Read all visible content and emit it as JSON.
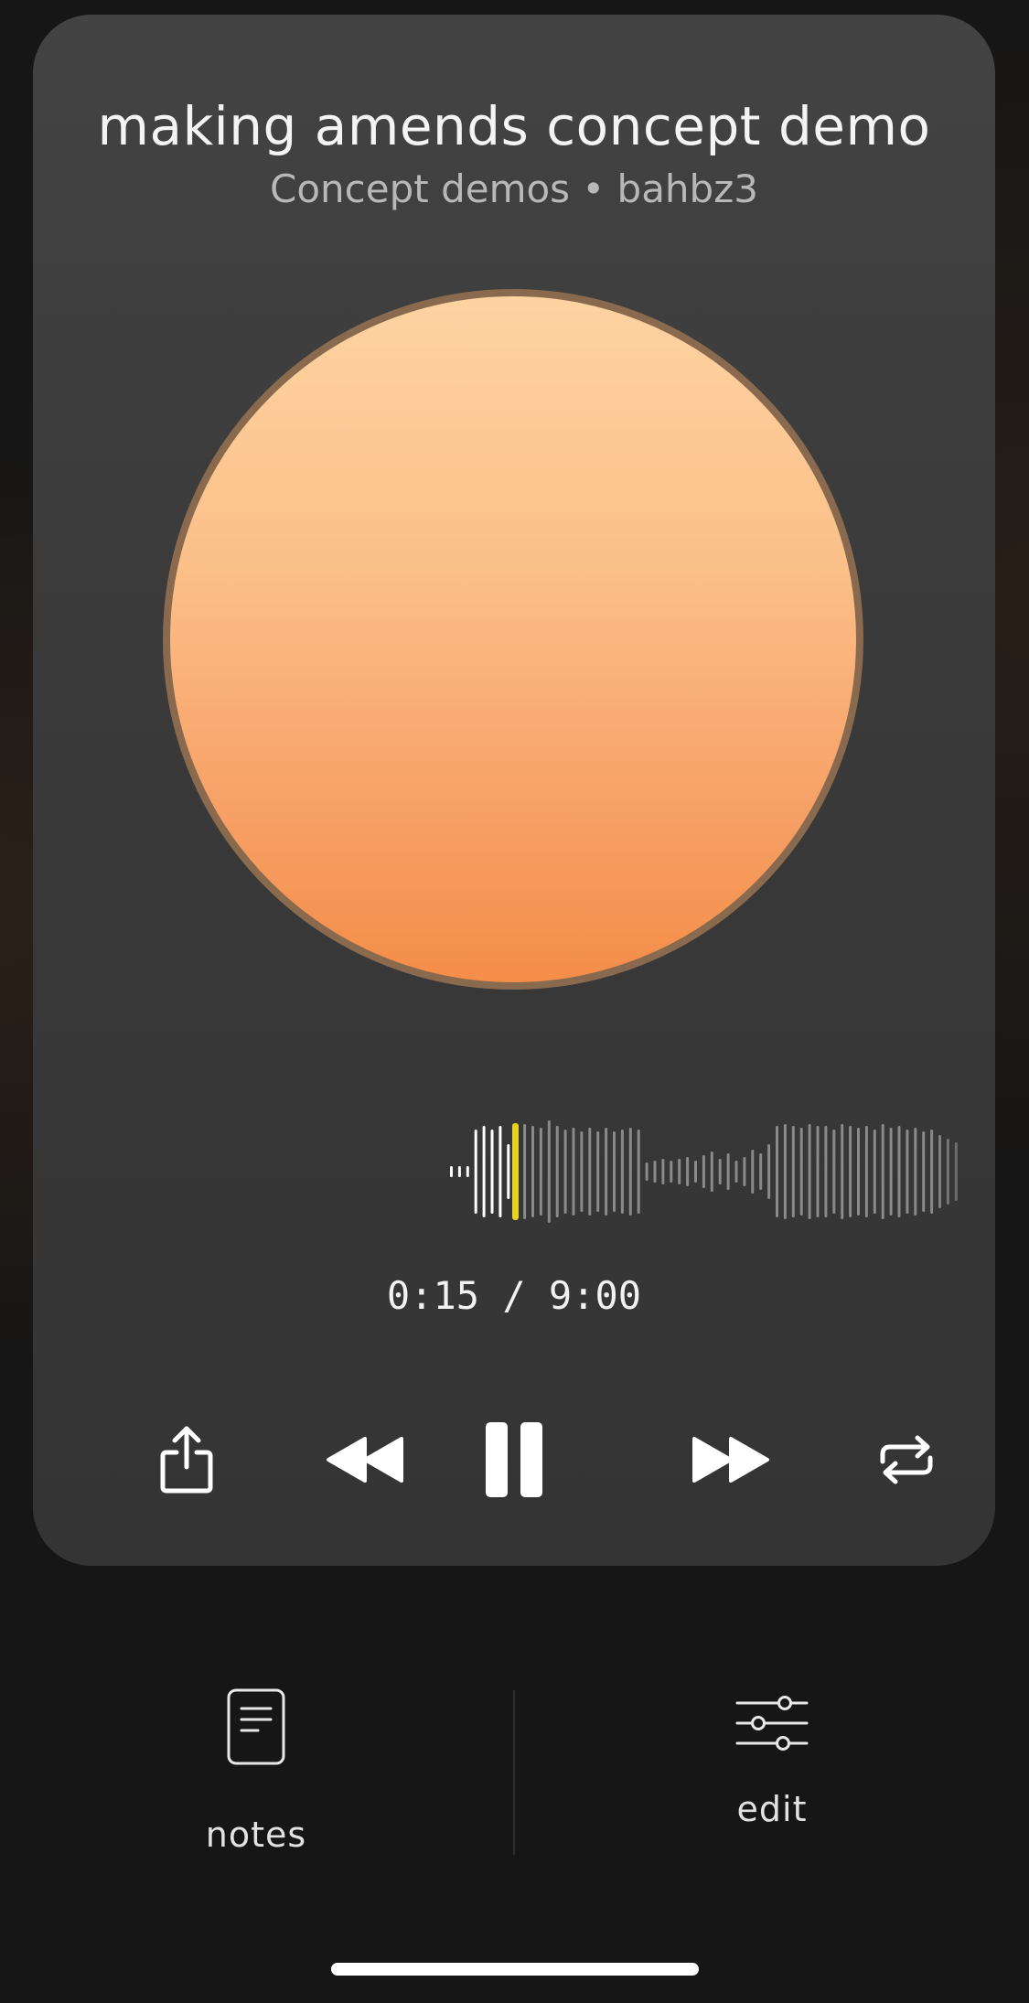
{
  "track": {
    "title": "making amends concept demo",
    "subtitle": "Concept demos • bahbz3"
  },
  "playback": {
    "time_display": "0:15 / 9:00",
    "elapsed_seconds": 15,
    "total_seconds": 540,
    "playhead_color": "#e7d21f",
    "played_color": "#ffffff",
    "unplayed_color": "#8a8a8a"
  },
  "controls": {
    "share_icon": "share-icon",
    "rewind_icon": "rewind-icon",
    "pause_icon": "pause-icon",
    "fast_forward_icon": "fast-forward-icon",
    "repeat_icon": "repeat-icon"
  },
  "bottom_bar": {
    "notes_label": "notes",
    "notes_icon": "document-icon",
    "edit_label": "edit",
    "edit_icon": "sliders-icon"
  },
  "colors": {
    "background": "#161616",
    "card": "#3c3c3c",
    "artwork_top": "#fed3a2",
    "artwork_bottom": "#f48d48",
    "artwork_ring": "#8a6a4e"
  }
}
